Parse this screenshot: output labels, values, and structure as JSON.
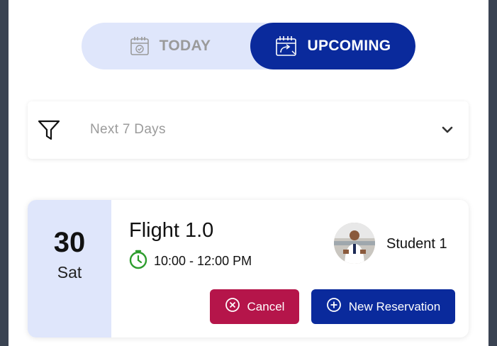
{
  "tabs": {
    "today_label": "TODAY",
    "upcoming_label": "UPCOMING",
    "active": "upcoming"
  },
  "filter": {
    "value": "Next 7 Days"
  },
  "reservation": {
    "day_number": "30",
    "day_name": "Sat",
    "title": "Flight 1.0",
    "time": "10:00 - 12:00 PM",
    "student_name": "Student 1",
    "cancel_label": "Cancel",
    "new_reservation_label": "New Reservation"
  },
  "colors": {
    "primary": "#0a2a9c",
    "toggle_bg": "#dfe6fb",
    "cancel": "#b5154a",
    "clock_green": "#2c9c2c",
    "frame": "#3a4352"
  },
  "icons": {
    "today": "calendar-check-icon",
    "upcoming": "calendar-arrow-icon",
    "filter": "funnel-icon",
    "dropdown": "chevron-down-icon",
    "time": "stopwatch-icon",
    "cancel": "circle-x-icon",
    "new": "circle-plus-icon"
  }
}
